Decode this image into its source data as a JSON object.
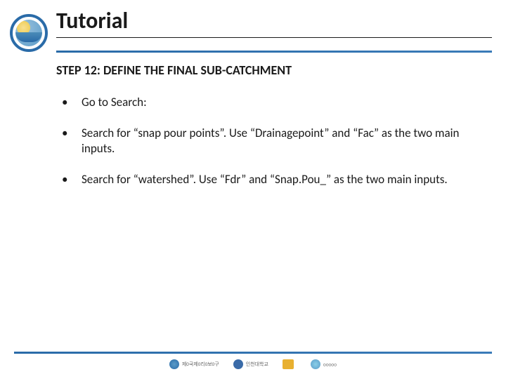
{
  "header": {
    "title": "Tutorial",
    "step_heading": "STEP 12: DEFINE THE FINAL SUB-CATCHMENT"
  },
  "bullets": [
    "Go to Search:",
    "Search for “snap pour points”. Use “Drainagepoint” and “Fac” as the two main inputs.",
    "Search for “watershed”. Use “Fdr” and “Snap.Pou_” as the two main inputs."
  ],
  "footer": {
    "logos": [
      "제0국제0리0보0구",
      "인천대학교",
      "",
      "○○○○○"
    ]
  }
}
